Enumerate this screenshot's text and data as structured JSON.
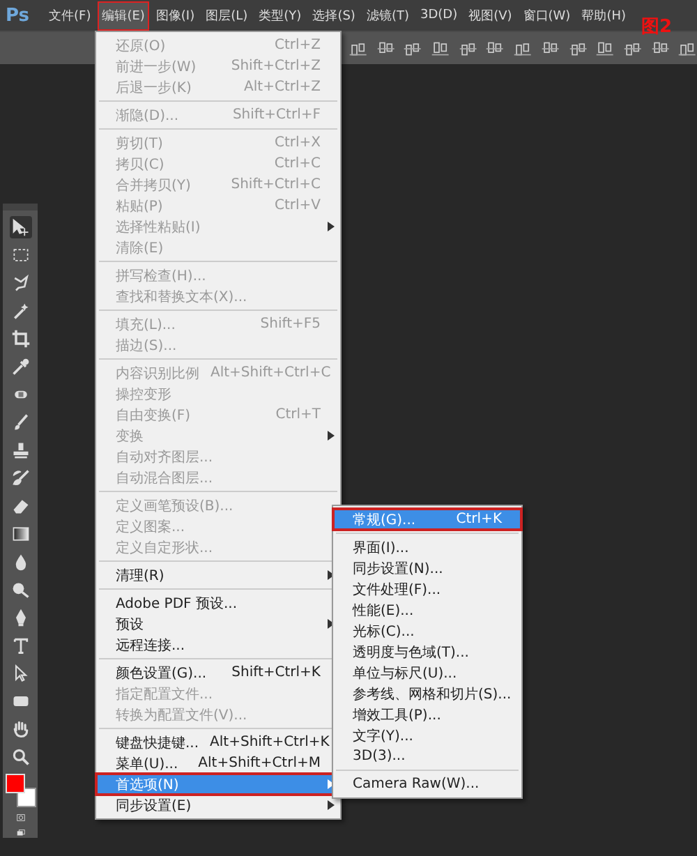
{
  "app": {
    "logo": "Ps"
  },
  "menubar": [
    {
      "label": "文件(F)",
      "selected": false,
      "marked": false
    },
    {
      "label": "编辑(E)",
      "selected": true,
      "marked": true
    },
    {
      "label": "图像(I)",
      "selected": false,
      "marked": false
    },
    {
      "label": "图层(L)",
      "selected": false,
      "marked": false
    },
    {
      "label": "类型(Y)",
      "selected": false,
      "marked": false
    },
    {
      "label": "选择(S)",
      "selected": false,
      "marked": false
    },
    {
      "label": "滤镜(T)",
      "selected": false,
      "marked": false
    },
    {
      "label": "3D(D)",
      "selected": false,
      "marked": false
    },
    {
      "label": "视图(V)",
      "selected": false,
      "marked": false
    },
    {
      "label": "窗口(W)",
      "selected": false,
      "marked": false
    },
    {
      "label": "帮助(H)",
      "selected": false,
      "marked": false
    }
  ],
  "annotation_label": "图2",
  "edit_menu": {
    "groups": [
      [
        {
          "label": "还原(O)",
          "shortcut": "Ctrl+Z",
          "submenu": false,
          "disabled": true,
          "selected": false,
          "marked": false
        },
        {
          "label": "前进一步(W)",
          "shortcut": "Shift+Ctrl+Z",
          "submenu": false,
          "disabled": true,
          "selected": false,
          "marked": false
        },
        {
          "label": "后退一步(K)",
          "shortcut": "Alt+Ctrl+Z",
          "submenu": false,
          "disabled": true,
          "selected": false,
          "marked": false
        }
      ],
      [
        {
          "label": "渐隐(D)...",
          "shortcut": "Shift+Ctrl+F",
          "submenu": false,
          "disabled": true,
          "selected": false,
          "marked": false
        }
      ],
      [
        {
          "label": "剪切(T)",
          "shortcut": "Ctrl+X",
          "submenu": false,
          "disabled": true,
          "selected": false,
          "marked": false
        },
        {
          "label": "拷贝(C)",
          "shortcut": "Ctrl+C",
          "submenu": false,
          "disabled": true,
          "selected": false,
          "marked": false
        },
        {
          "label": "合并拷贝(Y)",
          "shortcut": "Shift+Ctrl+C",
          "submenu": false,
          "disabled": true,
          "selected": false,
          "marked": false
        },
        {
          "label": "粘贴(P)",
          "shortcut": "Ctrl+V",
          "submenu": false,
          "disabled": true,
          "selected": false,
          "marked": false
        },
        {
          "label": "选择性粘贴(I)",
          "submenu": true,
          "disabled": true,
          "selected": false,
          "marked": false
        },
        {
          "label": "清除(E)",
          "submenu": false,
          "disabled": true,
          "selected": false,
          "marked": false
        }
      ],
      [
        {
          "label": "拼写检查(H)...",
          "submenu": false,
          "disabled": true,
          "selected": false,
          "marked": false
        },
        {
          "label": "查找和替换文本(X)...",
          "submenu": false,
          "disabled": true,
          "selected": false,
          "marked": false
        }
      ],
      [
        {
          "label": "填充(L)...",
          "shortcut": "Shift+F5",
          "submenu": false,
          "disabled": true,
          "selected": false,
          "marked": false
        },
        {
          "label": "描边(S)...",
          "submenu": false,
          "disabled": true,
          "selected": false,
          "marked": false
        }
      ],
      [
        {
          "label": "内容识别比例",
          "shortcut": "Alt+Shift+Ctrl+C",
          "submenu": false,
          "disabled": true,
          "selected": false,
          "marked": false
        },
        {
          "label": "操控变形",
          "submenu": false,
          "disabled": true,
          "selected": false,
          "marked": false
        },
        {
          "label": "自由变换(F)",
          "shortcut": "Ctrl+T",
          "submenu": false,
          "disabled": true,
          "selected": false,
          "marked": false
        },
        {
          "label": "变换",
          "submenu": true,
          "disabled": true,
          "selected": false,
          "marked": false
        },
        {
          "label": "自动对齐图层...",
          "submenu": false,
          "disabled": true,
          "selected": false,
          "marked": false
        },
        {
          "label": "自动混合图层...",
          "submenu": false,
          "disabled": true,
          "selected": false,
          "marked": false
        }
      ],
      [
        {
          "label": "定义画笔预设(B)...",
          "submenu": false,
          "disabled": true,
          "selected": false,
          "marked": false
        },
        {
          "label": "定义图案...",
          "submenu": false,
          "disabled": true,
          "selected": false,
          "marked": false
        },
        {
          "label": "定义自定形状...",
          "submenu": false,
          "disabled": true,
          "selected": false,
          "marked": false
        }
      ],
      [
        {
          "label": "清理(R)",
          "submenu": true,
          "disabled": false,
          "selected": false,
          "marked": false
        }
      ],
      [
        {
          "label": "Adobe PDF 预设...",
          "submenu": false,
          "disabled": false,
          "selected": false,
          "marked": false
        },
        {
          "label": "预设",
          "submenu": true,
          "disabled": false,
          "selected": false,
          "marked": false
        },
        {
          "label": "远程连接...",
          "submenu": false,
          "disabled": false,
          "selected": false,
          "marked": false
        }
      ],
      [
        {
          "label": "颜色设置(G)...",
          "shortcut": "Shift+Ctrl+K",
          "submenu": false,
          "disabled": false,
          "selected": false,
          "marked": false
        },
        {
          "label": "指定配置文件...",
          "submenu": false,
          "disabled": true,
          "selected": false,
          "marked": false
        },
        {
          "label": "转换为配置文件(V)...",
          "submenu": false,
          "disabled": true,
          "selected": false,
          "marked": false
        }
      ],
      [
        {
          "label": "键盘快捷键...",
          "shortcut": "Alt+Shift+Ctrl+K",
          "submenu": false,
          "disabled": false,
          "selected": false,
          "marked": false
        },
        {
          "label": "菜单(U)...",
          "shortcut": "Alt+Shift+Ctrl+M",
          "submenu": false,
          "disabled": false,
          "selected": false,
          "marked": false
        },
        {
          "label": "首选项(N)",
          "submenu": true,
          "disabled": false,
          "selected": true,
          "marked": true
        },
        {
          "label": "同步设置(E)",
          "submenu": true,
          "disabled": false,
          "selected": false,
          "marked": false
        }
      ]
    ]
  },
  "preferences_submenu": {
    "groups": [
      [
        {
          "label": "常规(G)...",
          "shortcut": "Ctrl+K",
          "submenu": false,
          "disabled": false,
          "selected": true,
          "marked": true
        }
      ],
      [
        {
          "label": "界面(I)...",
          "submenu": false,
          "disabled": false,
          "selected": false,
          "marked": false
        },
        {
          "label": "同步设置(N)...",
          "submenu": false,
          "disabled": false,
          "selected": false,
          "marked": false
        },
        {
          "label": "文件处理(F)...",
          "submenu": false,
          "disabled": false,
          "selected": false,
          "marked": false
        },
        {
          "label": "性能(E)...",
          "submenu": false,
          "disabled": false,
          "selected": false,
          "marked": false
        },
        {
          "label": "光标(C)...",
          "submenu": false,
          "disabled": false,
          "selected": false,
          "marked": false
        },
        {
          "label": "透明度与色域(T)...",
          "submenu": false,
          "disabled": false,
          "selected": false,
          "marked": false
        },
        {
          "label": "单位与标尺(U)...",
          "submenu": false,
          "disabled": false,
          "selected": false,
          "marked": false
        },
        {
          "label": "参考线、网格和切片(S)...",
          "submenu": false,
          "disabled": false,
          "selected": false,
          "marked": false
        },
        {
          "label": "增效工具(P)...",
          "submenu": false,
          "disabled": false,
          "selected": false,
          "marked": false
        },
        {
          "label": "文字(Y)...",
          "submenu": false,
          "disabled": false,
          "selected": false,
          "marked": false
        },
        {
          "label": "3D(3)...",
          "submenu": false,
          "disabled": false,
          "selected": false,
          "marked": false
        }
      ],
      [
        {
          "label": "Camera Raw(W)...",
          "submenu": false,
          "disabled": false,
          "selected": false,
          "marked": false
        }
      ]
    ]
  }
}
